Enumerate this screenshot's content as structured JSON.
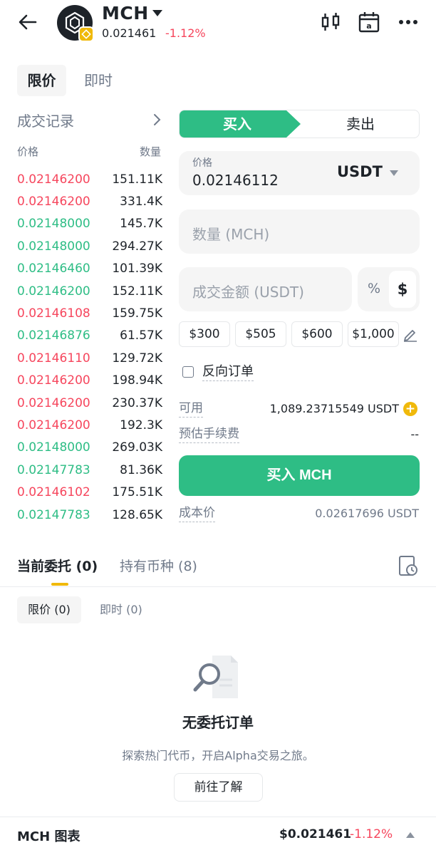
{
  "header": {
    "symbol": "MCH",
    "price": "0.021461",
    "change": "-1.12%",
    "icons": [
      "back-arrow-icon",
      "candlestick-icon",
      "calendar-icon",
      "more-icon"
    ]
  },
  "order_tabs": {
    "limit": "限价",
    "market": "即时"
  },
  "records": {
    "title": "成交记录",
    "price_header": "价格",
    "qty_header": "数量",
    "rows": [
      {
        "price": "0.02146200",
        "qty": "151.11K",
        "side": "down"
      },
      {
        "price": "0.02146200",
        "qty": "331.4K",
        "side": "down"
      },
      {
        "price": "0.02148000",
        "qty": "145.7K",
        "side": "up"
      },
      {
        "price": "0.02148000",
        "qty": "294.27K",
        "side": "up"
      },
      {
        "price": "0.02146460",
        "qty": "101.39K",
        "side": "up"
      },
      {
        "price": "0.02146200",
        "qty": "152.11K",
        "side": "up"
      },
      {
        "price": "0.02146108",
        "qty": "159.75K",
        "side": "down"
      },
      {
        "price": "0.02146876",
        "qty": "61.57K",
        "side": "up"
      },
      {
        "price": "0.02146110",
        "qty": "129.72K",
        "side": "down"
      },
      {
        "price": "0.02146200",
        "qty": "198.94K",
        "side": "down"
      },
      {
        "price": "0.02146200",
        "qty": "230.37K",
        "side": "down"
      },
      {
        "price": "0.02146200",
        "qty": "192.3K",
        "side": "down"
      },
      {
        "price": "0.02148000",
        "qty": "269.03K",
        "side": "up"
      },
      {
        "price": "0.02147783",
        "qty": "81.36K",
        "side": "up"
      },
      {
        "price": "0.02146102",
        "qty": "175.51K",
        "side": "down"
      },
      {
        "price": "0.02147783",
        "qty": "128.65K",
        "side": "up"
      }
    ]
  },
  "trade": {
    "buy_label": "买入",
    "sell_label": "卖出",
    "price_label": "价格",
    "price_value": "0.02146112",
    "quote_currency": "USDT",
    "qty_placeholder": "数量 (MCH)",
    "amount_placeholder": "成交金额 (USDT)",
    "unit_percent": "%",
    "unit_dollar": "$",
    "presets": [
      "$300",
      "$505",
      "$600",
      "$1,000"
    ],
    "reverse_order": "反向订单",
    "available_label": "可用",
    "available_value": "1,089.23715549 USDT",
    "fee_label": "预估手续费",
    "fee_value": "--",
    "submit_label": "买入 MCH",
    "cost_label": "成本价",
    "cost_value": "0.02617696 USDT"
  },
  "orders": {
    "tab_open": "当前委托 (0)",
    "tab_holdings": "持有币种 (8)",
    "sub_limit": "限价 (0)",
    "sub_market": "即时 (0)",
    "empty_title": "无委托订单",
    "empty_desc": "探索热门代币，开启Alpha交易之旅。",
    "explore_button": "前往了解"
  },
  "footer": {
    "title": "MCH 图表",
    "price": "$0.021461",
    "change": "-1.12%"
  },
  "colors": {
    "up": "#2ebd85",
    "down": "#f6465d",
    "accent": "#f0b90b"
  }
}
